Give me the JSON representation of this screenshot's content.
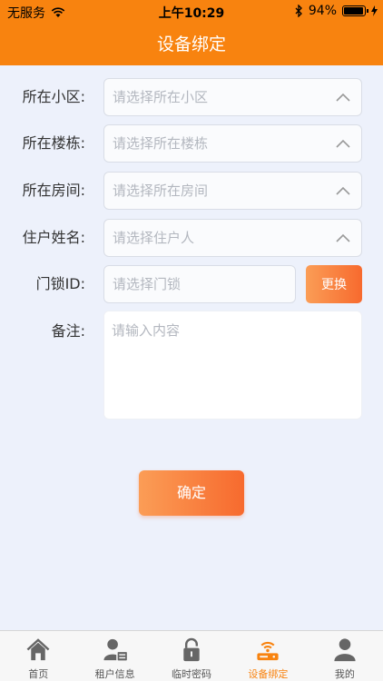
{
  "statusbar": {
    "carrier": "无服务",
    "time": "上午10:29",
    "battery": "94%",
    "battery_level": 0.94
  },
  "header": {
    "title": "设备绑定"
  },
  "form": {
    "community": {
      "label": "所在小区:",
      "placeholder": "请选择所在小区"
    },
    "building": {
      "label": "所在楼栋:",
      "placeholder": "请选择所在楼栋"
    },
    "room": {
      "label": "所在房间:",
      "placeholder": "请选择所在房间"
    },
    "resident": {
      "label": "住户姓名:",
      "placeholder": "请选择住户人"
    },
    "lock": {
      "label": "门锁ID:",
      "placeholder": "请选择门锁",
      "button": "更换"
    },
    "note": {
      "label": "备注:",
      "placeholder": "请输入内容"
    },
    "confirm": "确定"
  },
  "tabbar": {
    "items": [
      {
        "label": "首页",
        "icon": "home-icon"
      },
      {
        "label": "租户信息",
        "icon": "tenant-info-icon"
      },
      {
        "label": "临时密码",
        "icon": "lock-icon"
      },
      {
        "label": "设备绑定",
        "icon": "device-bind-icon",
        "active": true
      },
      {
        "label": "我的",
        "icon": "profile-icon"
      }
    ],
    "active_color": "#f8830f"
  },
  "colors": {
    "accent": "#f8830f",
    "background": "#edf1fb"
  }
}
